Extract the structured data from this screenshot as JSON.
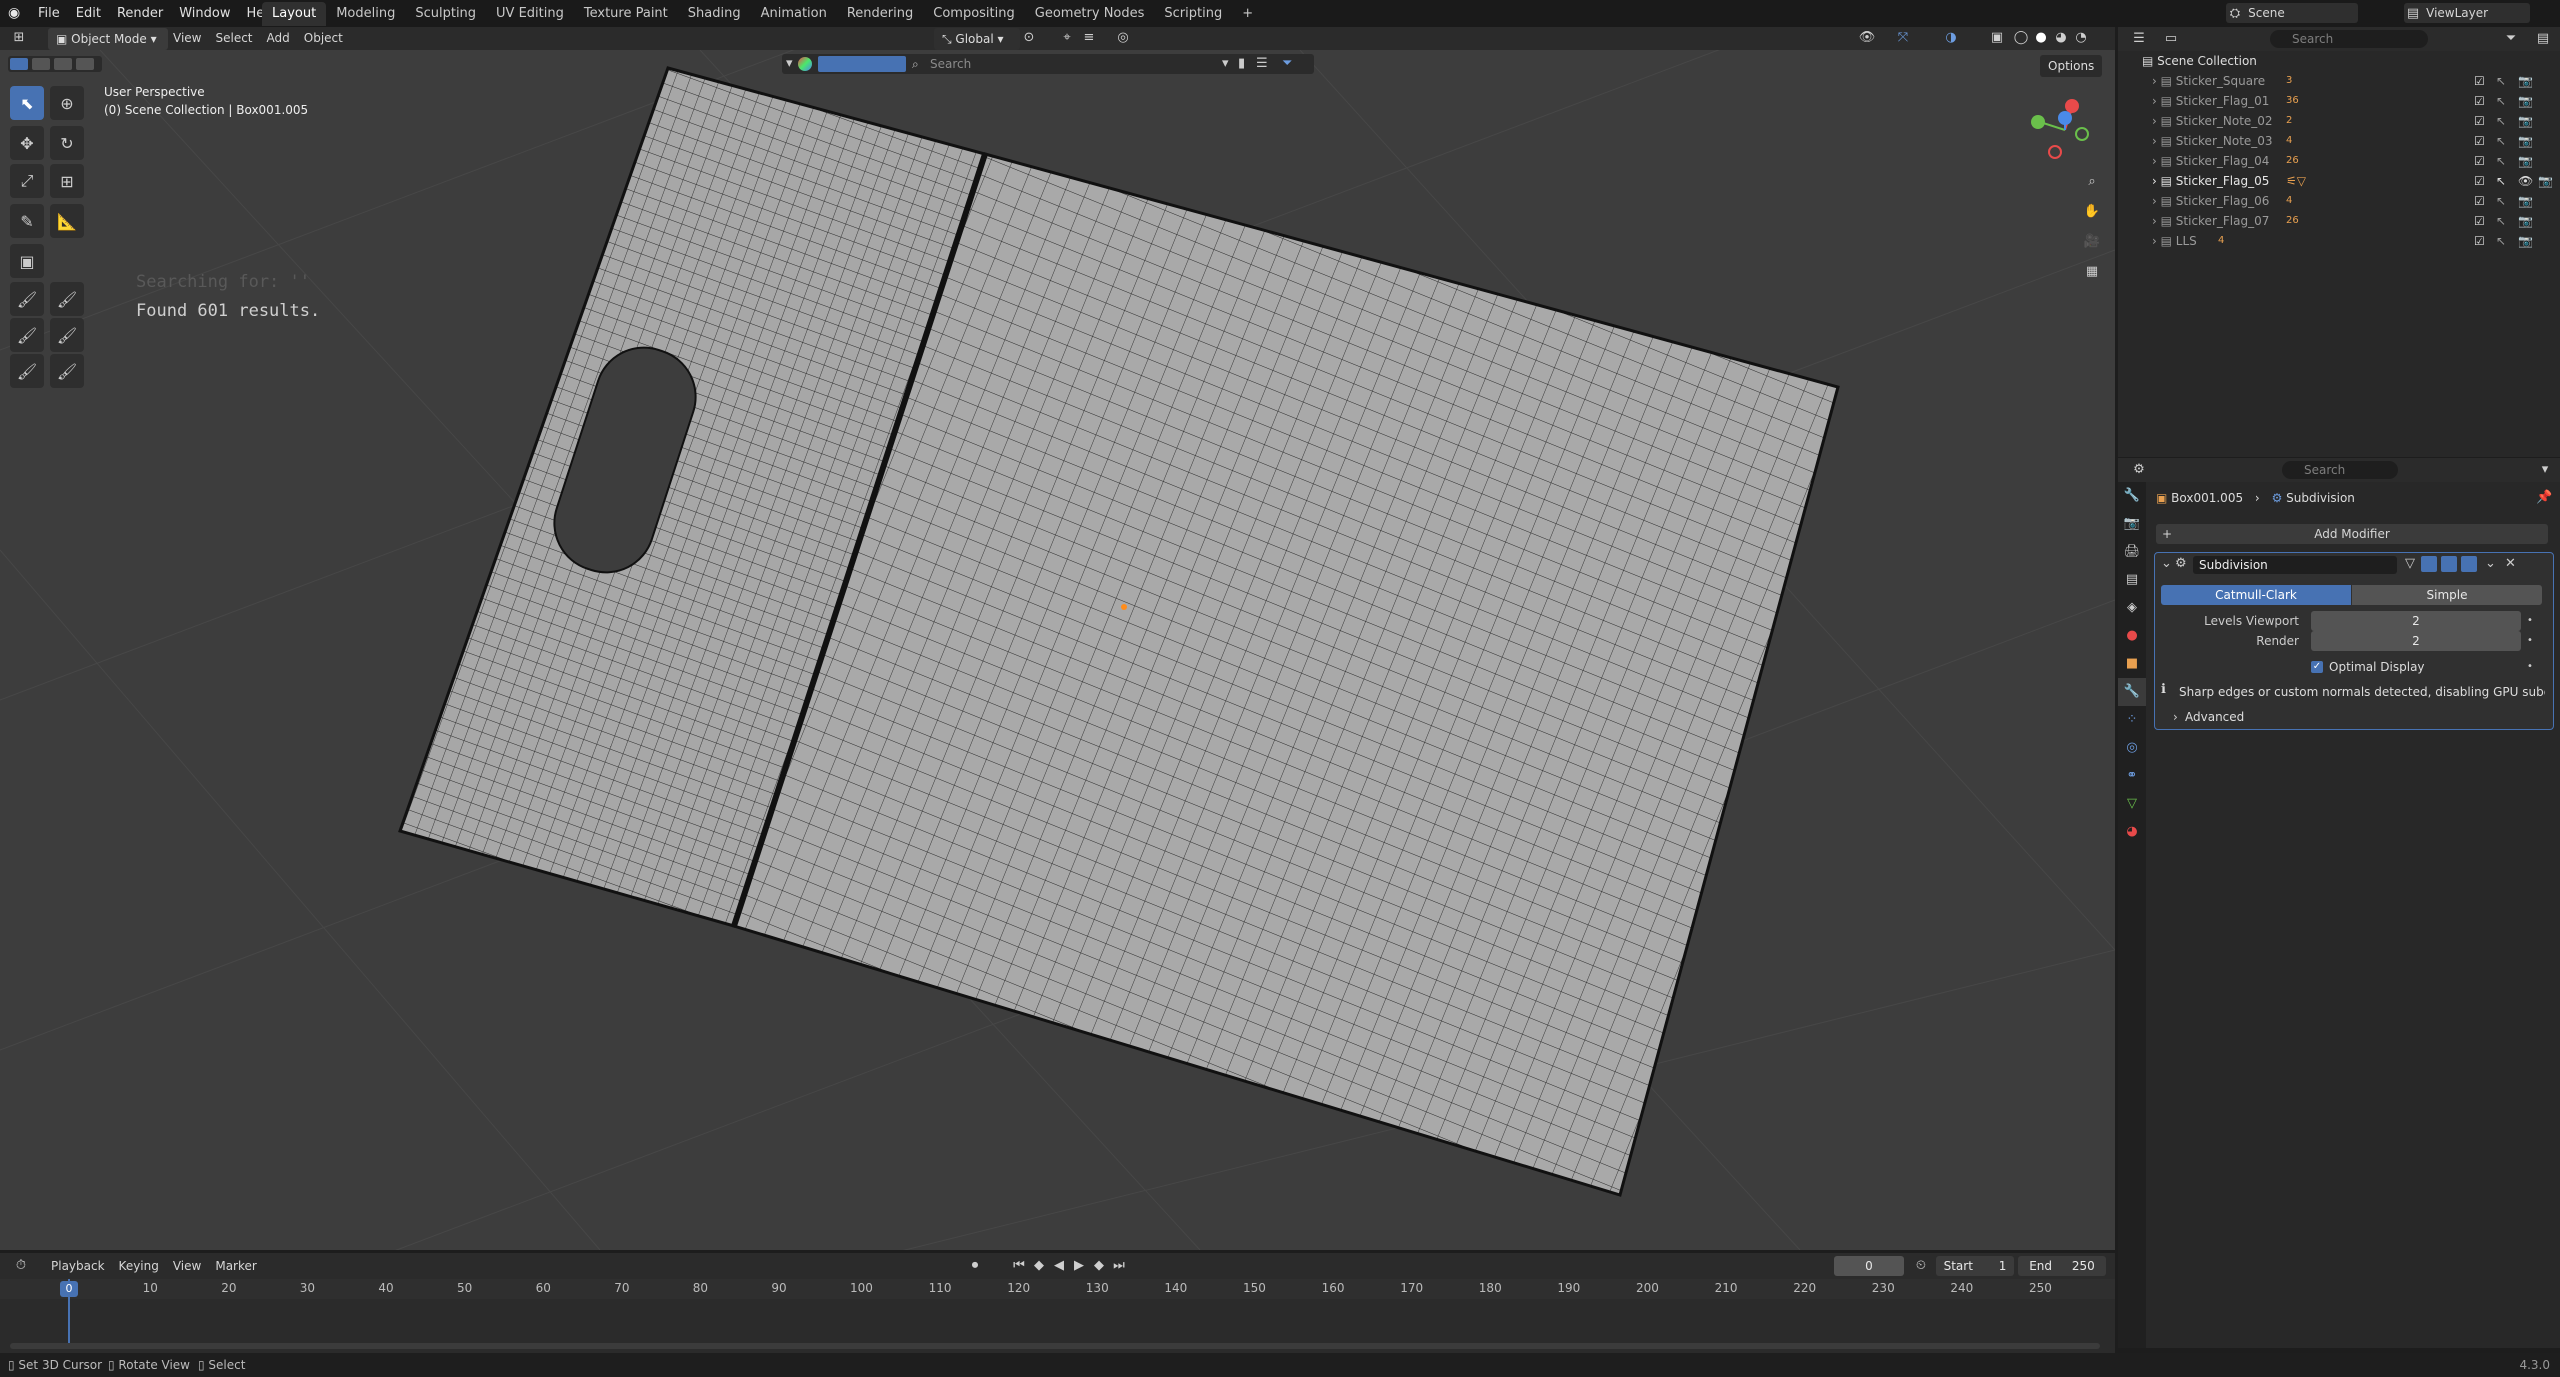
{
  "topbar": {
    "menus": [
      "File",
      "Edit",
      "Render",
      "Window",
      "Help"
    ],
    "workspaces": [
      "Layout",
      "Modeling",
      "Sculpting",
      "UV Editing",
      "Texture Paint",
      "Shading",
      "Animation",
      "Rendering",
      "Compositing",
      "Geometry Nodes",
      "Scripting"
    ],
    "active_workspace": "Layout",
    "plus": "+",
    "scene_label": "Scene",
    "viewlayer_label": "ViewLayer"
  },
  "viewport_header": {
    "mode": "Object Mode",
    "menus": [
      "View",
      "Select",
      "Add",
      "Object"
    ],
    "orientation": "Global",
    "search_placeholder": "Search",
    "options": "Options"
  },
  "viewport": {
    "perspective": "User Perspective",
    "collection_info": "(0) Scene Collection | Box001.005",
    "searching": "Searching for: ''",
    "results": "Found 601 results."
  },
  "outliner": {
    "search_placeholder": "Search",
    "root": "Scene Collection",
    "items": [
      {
        "name": "Sticker_Square",
        "badge": "3"
      },
      {
        "name": "Sticker_Flag_01",
        "badge": "36"
      },
      {
        "name": "Sticker_Note_02",
        "badge": "2"
      },
      {
        "name": "Sticker_Note_03",
        "badge": "4"
      },
      {
        "name": "Sticker_Flag_04",
        "badge": "26"
      },
      {
        "name": "Sticker_Flag_05",
        "badge": ""
      },
      {
        "name": "Sticker_Flag_06",
        "badge": "4"
      },
      {
        "name": "Sticker_Flag_07",
        "badge": "26"
      },
      {
        "name": "LLS",
        "badge": "4"
      }
    ]
  },
  "properties": {
    "search_placeholder": "Search",
    "breadcrumb_object": "Box001.005",
    "breadcrumb_modifier": "Subdivision",
    "add_modifier": "Add Modifier",
    "modifier_name": "Subdivision",
    "type_catmull": "Catmull-Clark",
    "type_simple": "Simple",
    "levels_viewport_label": "Levels Viewport",
    "levels_viewport_value": "2",
    "render_label": "Render",
    "render_value": "2",
    "optimal_display": "Optimal Display",
    "warning": "Sharp edges or custom normals detected, disabling GPU subdivi...",
    "advanced": "Advanced"
  },
  "timeline": {
    "menus": [
      "Playback",
      "Keying",
      "View",
      "Marker"
    ],
    "current_frame": "0",
    "start_label": "Start",
    "start_value": "1",
    "end_label": "End",
    "end_value": "250",
    "ticks": [
      "0",
      "10",
      "20",
      "30",
      "40",
      "50",
      "60",
      "70",
      "80",
      "90",
      "100",
      "110",
      "120",
      "130",
      "140",
      "150",
      "160",
      "170",
      "180",
      "190",
      "200",
      "210",
      "220",
      "230",
      "240",
      "250"
    ]
  },
  "statusbar": {
    "items": [
      "Set 3D Cursor",
      "Rotate View",
      "Select"
    ],
    "version": "4.3.0"
  },
  "colors": {
    "accent": "#4772b3",
    "viewport_bg": "#3d3d3d",
    "mesh_fill": "#a6a6a6"
  }
}
